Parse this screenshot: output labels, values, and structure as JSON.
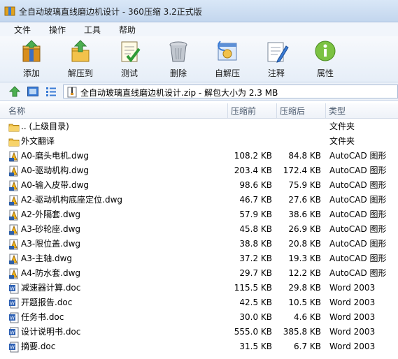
{
  "window": {
    "title": "全自动玻璃直线磨边机设计 - 360压缩 3.2正式版"
  },
  "menu": [
    "文件",
    "操作",
    "工具",
    "帮助"
  ],
  "toolbar": [
    {
      "label": "添加",
      "icon": "add-archive-icon"
    },
    {
      "label": "解压到",
      "icon": "extract-to-icon"
    },
    {
      "label": "测试",
      "icon": "test-icon"
    },
    {
      "label": "删除",
      "icon": "delete-trash-icon"
    },
    {
      "label": "自解压",
      "icon": "self-extract-icon"
    },
    {
      "label": "注释",
      "icon": "comment-icon"
    },
    {
      "label": "属性",
      "icon": "info-icon"
    }
  ],
  "address": {
    "path": "全自动玻璃直线磨边机设计.zip - 解包大小为 2.3 MB"
  },
  "columns": {
    "name": "名称",
    "size": "压缩前",
    "packed": "压缩后",
    "type": "类型"
  },
  "files": [
    {
      "name": ".. (上级目录)",
      "size": "",
      "packed": "",
      "type": "文件夹",
      "kind": "folder"
    },
    {
      "name": "外文翻译",
      "size": "",
      "packed": "",
      "type": "文件夹",
      "kind": "folder"
    },
    {
      "name": "A0-磨头电机.dwg",
      "size": "108.2 KB",
      "packed": "84.8 KB",
      "type": "AutoCAD 图形",
      "kind": "dwg"
    },
    {
      "name": "A0-驱动机构.dwg",
      "size": "203.4 KB",
      "packed": "172.4 KB",
      "type": "AutoCAD 图形",
      "kind": "dwg"
    },
    {
      "name": "A0-输入皮带.dwg",
      "size": "98.6 KB",
      "packed": "75.9 KB",
      "type": "AutoCAD 图形",
      "kind": "dwg"
    },
    {
      "name": "A2-驱动机构底座定位.dwg",
      "size": "46.7 KB",
      "packed": "27.6 KB",
      "type": "AutoCAD 图形",
      "kind": "dwg"
    },
    {
      "name": "A2-外隔套.dwg",
      "size": "57.9 KB",
      "packed": "38.6 KB",
      "type": "AutoCAD 图形",
      "kind": "dwg"
    },
    {
      "name": "A3-砂轮座.dwg",
      "size": "45.8 KB",
      "packed": "26.9 KB",
      "type": "AutoCAD 图形",
      "kind": "dwg"
    },
    {
      "name": "A3-限位盖.dwg",
      "size": "38.8 KB",
      "packed": "20.8 KB",
      "type": "AutoCAD 图形",
      "kind": "dwg"
    },
    {
      "name": "A3-主轴.dwg",
      "size": "37.2 KB",
      "packed": "19.3 KB",
      "type": "AutoCAD 图形",
      "kind": "dwg"
    },
    {
      "name": "A4-防水套.dwg",
      "size": "29.7 KB",
      "packed": "12.2 KB",
      "type": "AutoCAD 图形",
      "kind": "dwg"
    },
    {
      "name": "减速器计算.doc",
      "size": "115.5 KB",
      "packed": "29.8 KB",
      "type": "Word 2003",
      "kind": "doc"
    },
    {
      "name": "开题报告.doc",
      "size": "42.5 KB",
      "packed": "10.5 KB",
      "type": "Word 2003",
      "kind": "doc"
    },
    {
      "name": "任务书.doc",
      "size": "30.0 KB",
      "packed": "4.6 KB",
      "type": "Word 2003",
      "kind": "doc"
    },
    {
      "name": "设计说明书.doc",
      "size": "555.0 KB",
      "packed": "385.8 KB",
      "type": "Word 2003",
      "kind": "doc"
    },
    {
      "name": "摘要.doc",
      "size": "31.5 KB",
      "packed": "6.7 KB",
      "type": "Word 2003",
      "kind": "doc"
    }
  ]
}
